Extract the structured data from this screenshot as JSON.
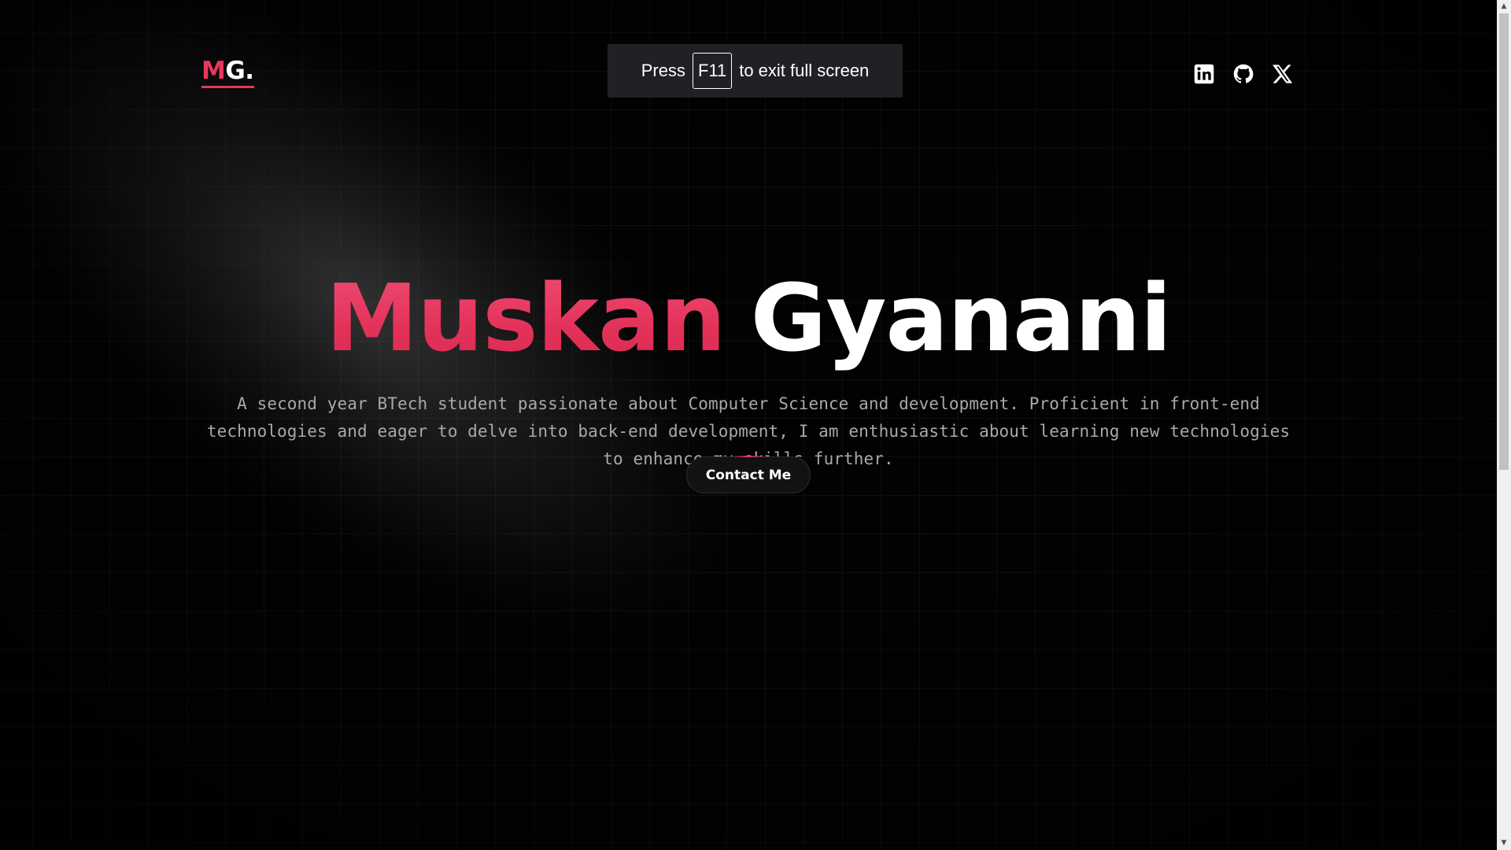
{
  "nav": {
    "logo_first": "M",
    "logo_rest": "G.",
    "social": [
      {
        "name": "LinkedIn",
        "icon": "linkedin-icon"
      },
      {
        "name": "GitHub",
        "icon": "github-icon"
      },
      {
        "name": "X",
        "icon": "x-icon"
      }
    ]
  },
  "fullscreen_toast": {
    "prefix": "Press",
    "key": "F11",
    "suffix": "to exit full screen"
  },
  "hero": {
    "first_name": "Muskan",
    "last_name": "Gyanani",
    "description": "A second year BTech student passionate about Computer Science and development. Proficient in front-end technologies and eager to delve into back-end development, I am enthusiastic about learning new technologies to enhance my skills further.",
    "cta_label": "Contact Me"
  },
  "colors": {
    "accent": "#e8375c",
    "background": "#020202",
    "text": "#ffffff",
    "muted_text": "#a9a9a9"
  }
}
